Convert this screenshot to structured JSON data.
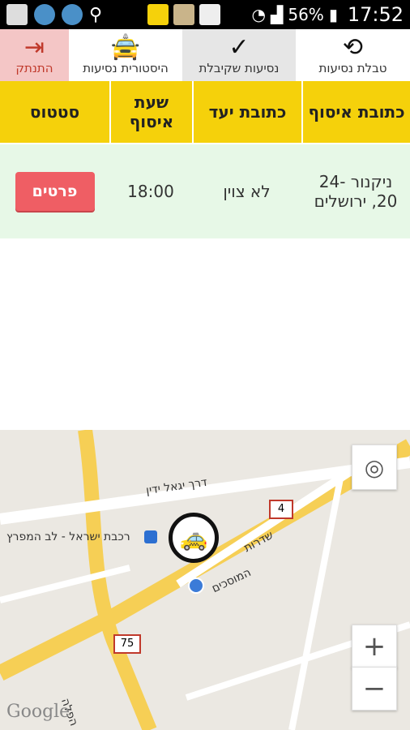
{
  "status_bar": {
    "battery": "56%",
    "time": "17:52"
  },
  "tabs": {
    "logout": "התנתק",
    "history": "היסטורית נסיעות",
    "accepted": "נסיעות שקיבלת",
    "table": "טבלת נסיעות"
  },
  "table": {
    "headers": {
      "status": "סטטוס",
      "pickup_time": "שעת איסוף",
      "destination": "כתובת יעד",
      "pickup_address": "כתובת איסוף"
    },
    "rows": [
      {
        "status_button": "פרטים",
        "pickup_time": "18:00",
        "destination": "לא צוין",
        "pickup_address": "ניקנור 24-20, ירושלים"
      }
    ]
  },
  "map": {
    "street_1": "דרך יגאל ידין",
    "station": "רכבת ישראל - לב המפרץ",
    "street_2": "שדרות",
    "street_3": "המוסכים",
    "street_4": "הפלה",
    "road_4": "4",
    "road_75": "75",
    "attribution": "Google",
    "zoom_in": "+",
    "zoom_out": "−"
  }
}
